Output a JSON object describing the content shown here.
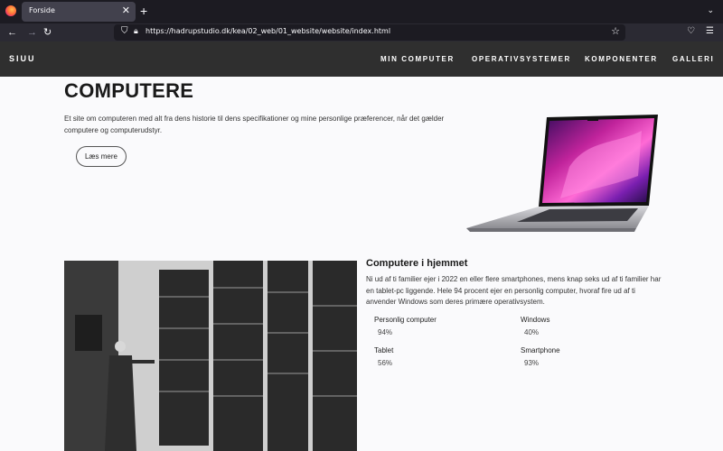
{
  "browser": {
    "tab_title": "Forside",
    "tab_close": "✕",
    "new_tab": "+",
    "url": "https://hadrupstudio.dk/kea/02_web/01_website/website/index.html"
  },
  "site": {
    "brand": "SIUU",
    "nav": [
      "MIN COMPUTER",
      "OPERATIVSYSTEMER",
      "KOMPONENTER",
      "GALLERI"
    ]
  },
  "hero": {
    "title": "COMPUTERE",
    "text": "Et site om computeren med alt fra dens historie til dens specifikationer og mine personlige præferencer, når det gælder computere og computerudstyr.",
    "button": "Læs mere"
  },
  "info": {
    "title": "Computere i hjemmet",
    "text": "Ni ud af ti familier ejer i 2022 en eller flere smartphones, mens knap seks ud af ti familier har en tablet-pc liggende. Hele 94 procent ejer en personlig computer, hvoraf fire ud af ti anvender Windows som deres primære operativsystem.",
    "stats": [
      {
        "label": "Personlig computer",
        "value": "94%"
      },
      {
        "label": "Windows",
        "value": "40%"
      },
      {
        "label": "Tablet",
        "value": "56%"
      },
      {
        "label": "Smartphone",
        "value": "93%"
      }
    ]
  },
  "icons": {
    "back": "back-arrow-icon",
    "forward": "forward-arrow-icon",
    "reload": "reload-icon",
    "shield": "shield-icon",
    "lock": "lock-icon",
    "star": "bookmark-star-icon",
    "pocket": "pocket-icon",
    "menu": "hamburger-menu-icon"
  },
  "colors": {
    "browser_bg": "#1c1b22",
    "site_header": "#2f2f2f",
    "page_bg": "#fafafc"
  }
}
